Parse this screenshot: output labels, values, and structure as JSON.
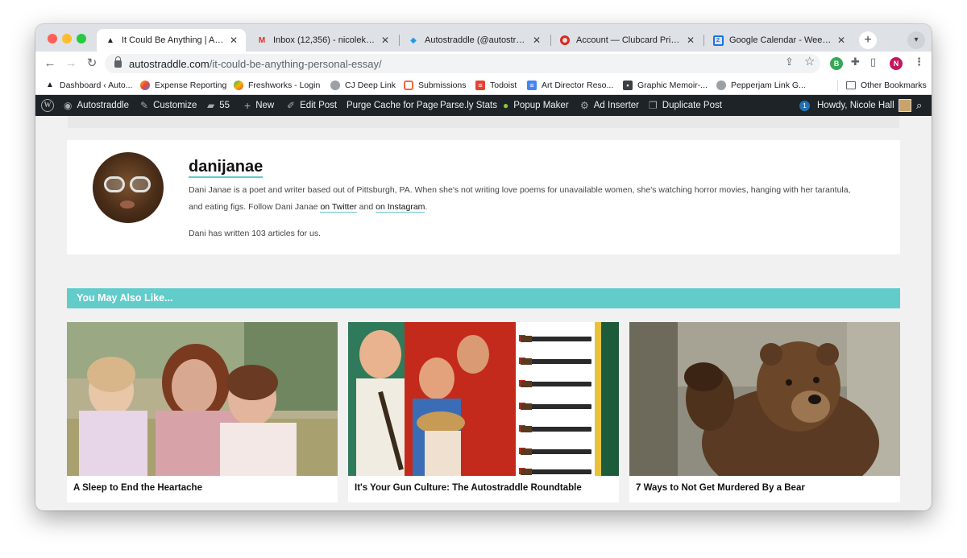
{
  "tabs": [
    {
      "title": "It Could Be Anything | Autostraddle",
      "icon": "autostraddle-triangle-icon",
      "active": true
    },
    {
      "title": "Inbox (12,356) - nicolekristenhall",
      "icon": "gmail-icon"
    },
    {
      "title": "Autostraddle (@autostraddle) / Twitter",
      "icon": "twitter-bird-icon"
    },
    {
      "title": "Account — Clubcard Printing USA",
      "icon": "clubcard-icon"
    },
    {
      "title": "Google Calendar - Week of June",
      "icon": "google-calendar-icon"
    }
  ],
  "address": {
    "domain": "autostraddle.com",
    "path": "/it-could-be-anything-personal-essay/"
  },
  "bookmarks": [
    {
      "label": "Dashboard ‹ Auto...",
      "icon": "triangle-icon"
    },
    {
      "label": "Expense Reporting",
      "icon": "pinwheel-icon"
    },
    {
      "label": "Freshworks - Login",
      "icon": "freshworks-icon"
    },
    {
      "label": "CJ Deep Link",
      "icon": "globe-icon"
    },
    {
      "label": "Submissions",
      "icon": "submittable-icon"
    },
    {
      "label": "Todoist",
      "icon": "todoist-icon"
    },
    {
      "label": "Art Director Reso...",
      "icon": "google-docs-icon"
    },
    {
      "label": "Graphic Memoir-...",
      "icon": "image-icon"
    },
    {
      "label": "Pepperjam Link G...",
      "icon": "globe-icon"
    }
  ],
  "other_bookmarks": "Other Bookmarks",
  "admin_bar": {
    "site": "Autostraddle",
    "customize": "Customize",
    "comments": "55",
    "new": "New",
    "edit_post": "Edit Post",
    "purge": "Purge Cache for Page",
    "parsely": "Parse.ly Stats",
    "popup": "Popup Maker",
    "ad_inserter": "Ad Inserter",
    "duplicate": "Duplicate Post",
    "notifications": "1",
    "howdy": "Howdy, Nicole Hall"
  },
  "author": {
    "name": "danijanae",
    "bio_1": "Dani Janae is a poet and writer based out of Pittsburgh, PA. When she's not writing love poems for unavailable women, she's watching horror movies, hanging with her tarantula, and eating figs. Follow Dani Janae ",
    "bio_link_twitter": "on Twitter",
    "bio_and": " and ",
    "bio_link_instagram": "on Instagram",
    "bio_end": ".",
    "article_count": "Dani has written 103 articles for us."
  },
  "related": {
    "heading": "You May Also Like...",
    "items": [
      {
        "title": "A Sleep to End the Heartache"
      },
      {
        "title": "It's Your Gun Culture: The Autostraddle Roundtable"
      },
      {
        "title": "7 Ways to Not Get Murdered By a Bear"
      }
    ]
  },
  "colors": {
    "accent": "#62cccb",
    "admin_bar": "#1d2327"
  }
}
